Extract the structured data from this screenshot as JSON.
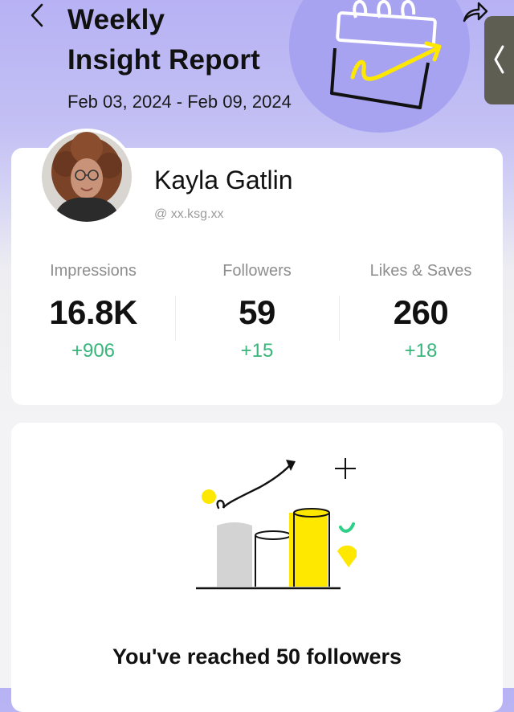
{
  "header": {
    "title_line1": "Weekly",
    "title_line2": "Insight Report",
    "date_range": "Feb 03, 2024 - Feb 09, 2024"
  },
  "profile": {
    "name": "Kayla Gatlin",
    "handle": "@ xx.ksg.xx"
  },
  "stats": [
    {
      "label": "Impressions",
      "value": "16.8K",
      "delta": "+906"
    },
    {
      "label": "Followers",
      "value": "59",
      "delta": "+15"
    },
    {
      "label": "Likes & Saves",
      "value": "260",
      "delta": "+18"
    }
  ],
  "milestone": {
    "title": "You've reached 50 followers"
  },
  "colors": {
    "accent_green": "#37b57a",
    "header_purple": "#b7b2f4",
    "illustration_yellow": "#ffe800",
    "side_tab": "#5f5e52"
  },
  "icons": [
    "back-icon",
    "share-icon",
    "collapse-tab-icon",
    "calendar-growth-illustration",
    "growth-bars-illustration"
  ]
}
